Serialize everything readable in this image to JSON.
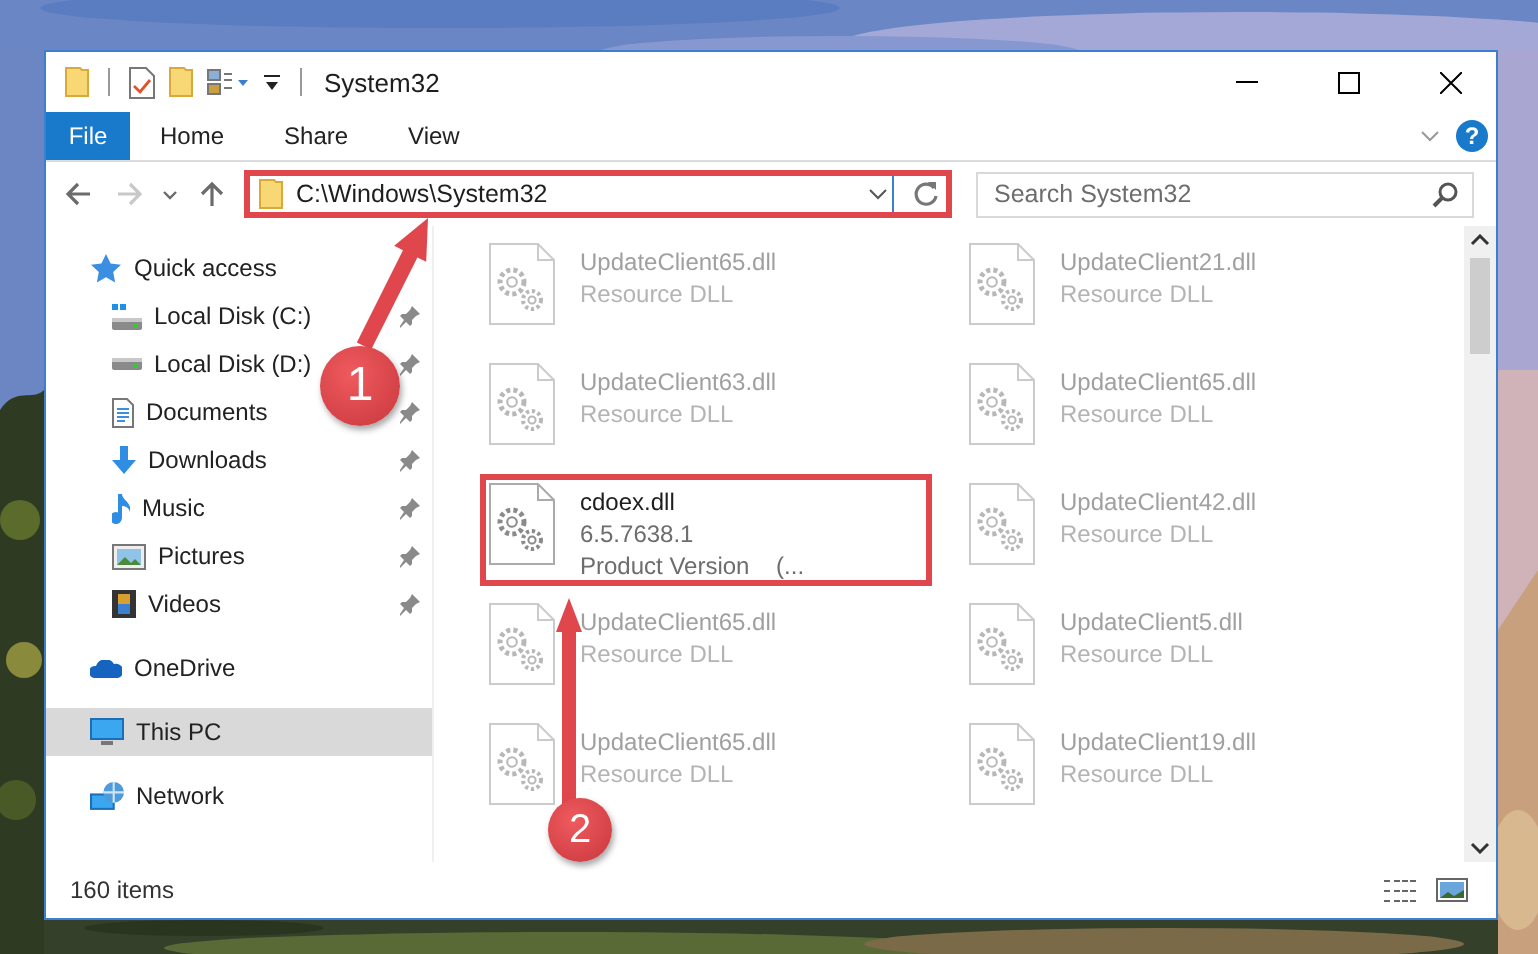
{
  "window": {
    "title": "System32"
  },
  "ribbon": {
    "tabs": [
      {
        "label": "File",
        "kind": "file",
        "selected": false
      },
      {
        "label": "Home",
        "kind": "plain",
        "selected": false
      },
      {
        "label": "Share",
        "kind": "plain",
        "selected": false
      },
      {
        "label": "View",
        "kind": "plain",
        "selected": false
      }
    ],
    "help": "?"
  },
  "navigation": [
    {
      "kind": "back",
      "disabled": false
    },
    {
      "kind": "forward",
      "disabled": true
    },
    {
      "kind": "recent",
      "disabled": false
    },
    {
      "kind": "up",
      "disabled": false
    }
  ],
  "address": {
    "path": "C:\\Windows\\System32",
    "highlighted": true
  },
  "search": {
    "placeholder": "Search System32"
  },
  "sidebar": {
    "items": [
      {
        "label": "Quick access",
        "kind": "star",
        "selected": false,
        "children": [
          {
            "label": "Local Disk (C:)",
            "kind": "system-drive",
            "pinned": true,
            "selected": false
          },
          {
            "label": "Local Disk (D:)",
            "kind": "drive",
            "pinned": true,
            "selected": false
          },
          {
            "label": "Documents",
            "kind": "documents",
            "pinned": true,
            "selected": false
          },
          {
            "label": "Downloads",
            "kind": "downloads",
            "pinned": true,
            "selected": false
          },
          {
            "label": "Music",
            "kind": "music",
            "pinned": true,
            "selected": false
          },
          {
            "label": "Pictures",
            "kind": "pictures",
            "pinned": true,
            "selected": false
          },
          {
            "label": "Videos",
            "kind": "videos",
            "pinned": true,
            "selected": false
          }
        ]
      },
      {
        "label": "OneDrive",
        "kind": "cloud",
        "selected": false
      },
      {
        "label": "This PC",
        "kind": "computer",
        "selected": true
      },
      {
        "label": "Network",
        "kind": "network",
        "selected": false
      }
    ]
  },
  "files": [
    {
      "lines": [
        "UpdateClient65.dll",
        "Resource DLL"
      ],
      "faded": true,
      "highlighted": false
    },
    {
      "lines": [
        "UpdateClient21.dll",
        "Resource DLL"
      ],
      "faded": true,
      "highlighted": false
    },
    {
      "lines": [
        "UpdateClient63.dll",
        "Resource DLL"
      ],
      "faded": true,
      "highlighted": false
    },
    {
      "lines": [
        "UpdateClient65.dll",
        "Resource DLL"
      ],
      "faded": true,
      "highlighted": false
    },
    {
      "lines": [
        "cdoex.dll",
        "6.5.7638.1",
        "Product Version    (..."
      ],
      "faded": false,
      "highlighted": true
    },
    {
      "lines": [
        "UpdateClient42.dll",
        "Resource DLL"
      ],
      "faded": true,
      "highlighted": false
    },
    {
      "lines": [
        "UpdateClient65.dll",
        "Resource DLL"
      ],
      "faded": true,
      "highlighted": false
    },
    {
      "lines": [
        "UpdateClient5.dll",
        "Resource DLL"
      ],
      "faded": true,
      "highlighted": false
    },
    {
      "lines": [
        "UpdateClient65.dll",
        "Resource DLL"
      ],
      "faded": true,
      "highlighted": false
    },
    {
      "lines": [
        "UpdateClient19.dll",
        "Resource DLL"
      ],
      "faded": true,
      "highlighted": false
    }
  ],
  "callouts": [
    {
      "number": "1"
    },
    {
      "number": "2"
    }
  ],
  "status_bar": {
    "count": "160 items"
  }
}
